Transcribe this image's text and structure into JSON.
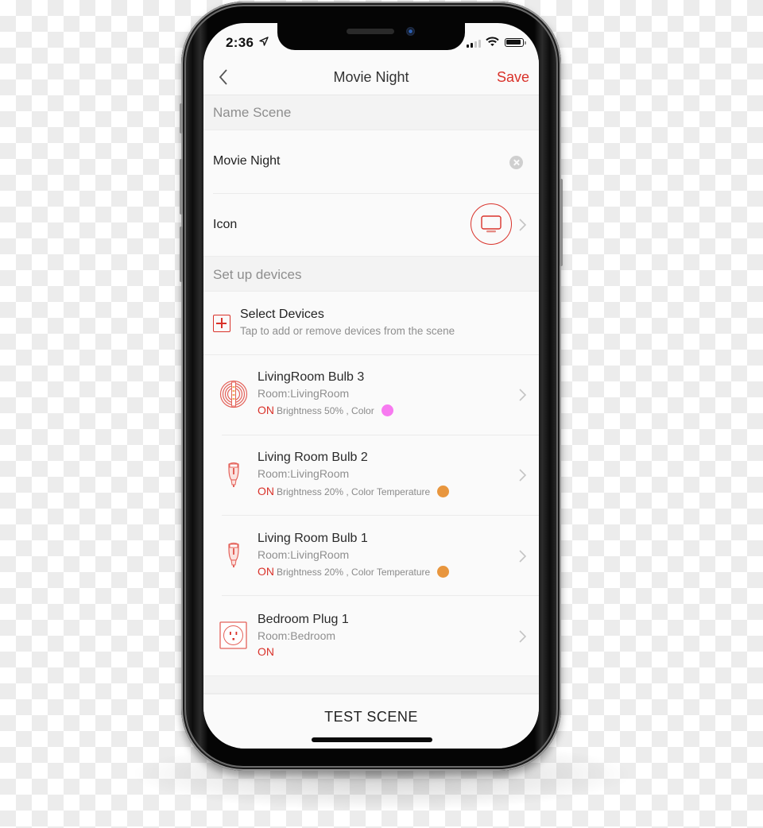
{
  "status_bar": {
    "time": "2:36",
    "location_icon": "location-arrow-icon",
    "signal_icon": "cellular-signal-icon",
    "wifi_icon": "wifi-icon",
    "battery_icon": "battery-icon"
  },
  "nav": {
    "back_icon": "chevron-left-icon",
    "title": "Movie Night",
    "save_label": "Save"
  },
  "name_section": {
    "header": "Name Scene",
    "name_value": "Movie Night",
    "clear_icon": "clear-circle-icon",
    "icon_label": "Icon",
    "selected_icon": "tv-icon"
  },
  "devices_section": {
    "header": "Set up devices",
    "select_title": "Select Devices",
    "select_subtitle": "Tap to add or remove devices from the scene",
    "select_icon": "plus-square-icon"
  },
  "devices": [
    {
      "name": "LivingRoom Bulb 3",
      "room": "Room:LivingRoom",
      "state": "ON",
      "detail": "Brightness 50% , Color",
      "swatch": "#f77af0",
      "icon": "lightstrip-icon"
    },
    {
      "name": "Living Room Bulb 2",
      "room": "Room:LivingRoom",
      "state": "ON",
      "detail": "Brightness 20% , Color Temperature",
      "swatch": "#e8963e",
      "icon": "bulb-icon"
    },
    {
      "name": "Living Room Bulb 1",
      "room": "Room:LivingRoom",
      "state": "ON",
      "detail": "Brightness 20% , Color Temperature",
      "swatch": "#e8963e",
      "icon": "bulb-icon"
    },
    {
      "name": "Bedroom Plug 1",
      "room": "Room:Bedroom",
      "state": "ON",
      "detail": "",
      "swatch": null,
      "icon": "smart-plug-icon"
    }
  ],
  "footer": {
    "test_scene_label": "TEST SCENE"
  },
  "colors": {
    "accent": "#d9322a",
    "background": "#fafafa",
    "section_header_bg": "#f3f3f3"
  }
}
